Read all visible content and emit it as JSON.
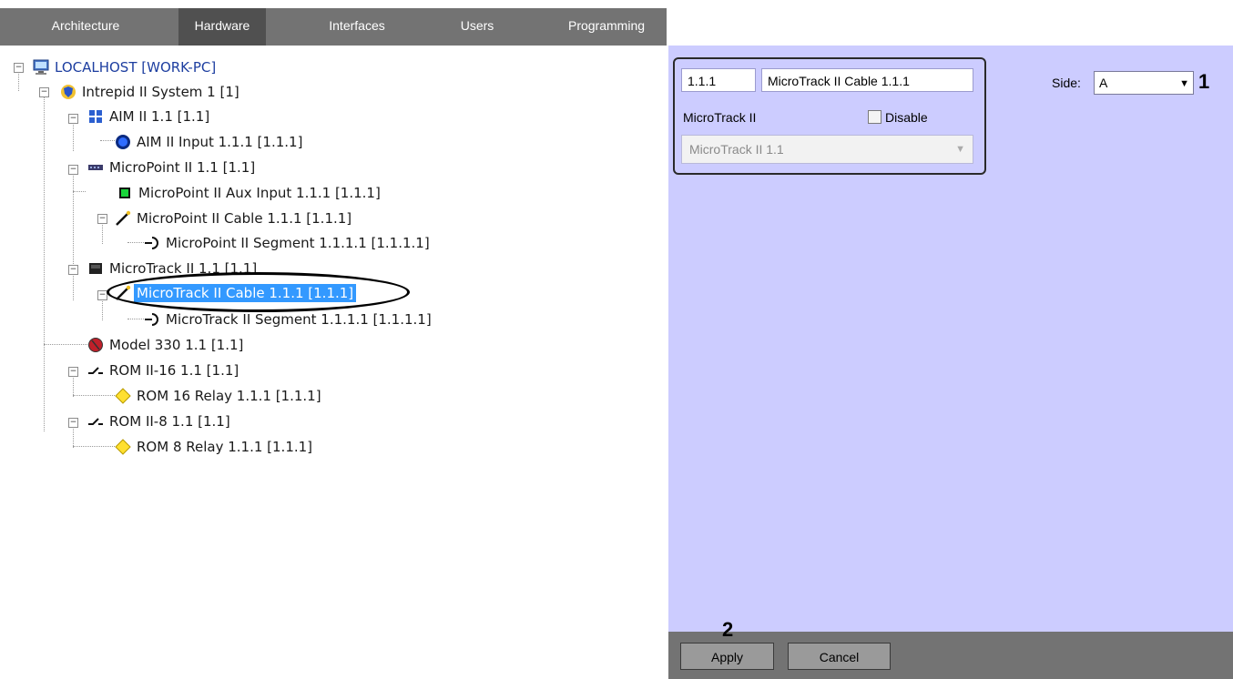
{
  "tabs": [
    {
      "label": "Architecture"
    },
    {
      "label": "Hardware"
    },
    {
      "label": "Interfaces"
    },
    {
      "label": "Users"
    },
    {
      "label": "Programming"
    }
  ],
  "active_tab": "Hardware",
  "tree": {
    "nodes": [
      {
        "label": "LOCALHOST [WORK-PC]",
        "icon": "computer-icon"
      },
      {
        "label": "Intrepid II System 1 [1]",
        "icon": "shield-icon"
      },
      {
        "label": "AIM II 1.1 [1.1]",
        "icon": "grid-module-icon"
      },
      {
        "label": "AIM II Input 1.1.1 [1.1.1]",
        "icon": "blue-circle-icon"
      },
      {
        "label": "MicroPoint II 1.1 [1.1]",
        "icon": "device-icon"
      },
      {
        "label": "MicroPoint II Aux Input 1.1.1 [1.1.1]",
        "icon": "green-square-icon"
      },
      {
        "label": "MicroPoint II Cable 1.1.1 [1.1.1]",
        "icon": "cable-icon"
      },
      {
        "label": "MicroPoint II Segment 1.1.1.1 [1.1.1.1]",
        "icon": "segment-icon"
      },
      {
        "label": "MicroTrack II 1.1 [1.1]",
        "icon": "device-dark-icon"
      },
      {
        "label": "MicroTrack II Cable 1.1.1 [1.1.1]",
        "icon": "cable-icon"
      },
      {
        "label": "MicroTrack II Segment 1.1.1.1 [1.1.1.1]",
        "icon": "segment-icon"
      },
      {
        "label": "Model 330 1.1 [1.1]",
        "icon": "red-sphere-icon"
      },
      {
        "label": "ROM II-16 1.1 [1.1]",
        "icon": "switch-icon"
      },
      {
        "label": "ROM 16 Relay 1.1.1 [1.1.1]",
        "icon": "yellow-diamond-icon"
      },
      {
        "label": "ROM II-8 1.1 [1.1]",
        "icon": "switch-icon"
      },
      {
        "label": "ROM 8 Relay 1.1.1 [1.1.1]",
        "icon": "yellow-diamond-icon"
      }
    ],
    "selected": "MicroTrack II Cable 1.1.1 [1.1.1]"
  },
  "props": {
    "id_value": "1.1.1",
    "name_value": "MicroTrack II Cable 1.1.1",
    "parent_label": "MicroTrack II",
    "disable_label": "Disable",
    "disable_checked": false,
    "parent_combo_value": "MicroTrack II 1.1",
    "side_label": "Side:",
    "side_value": "A",
    "marker_1": "1",
    "marker_2": "2"
  },
  "buttons": {
    "apply": "Apply",
    "cancel": "Cancel"
  }
}
